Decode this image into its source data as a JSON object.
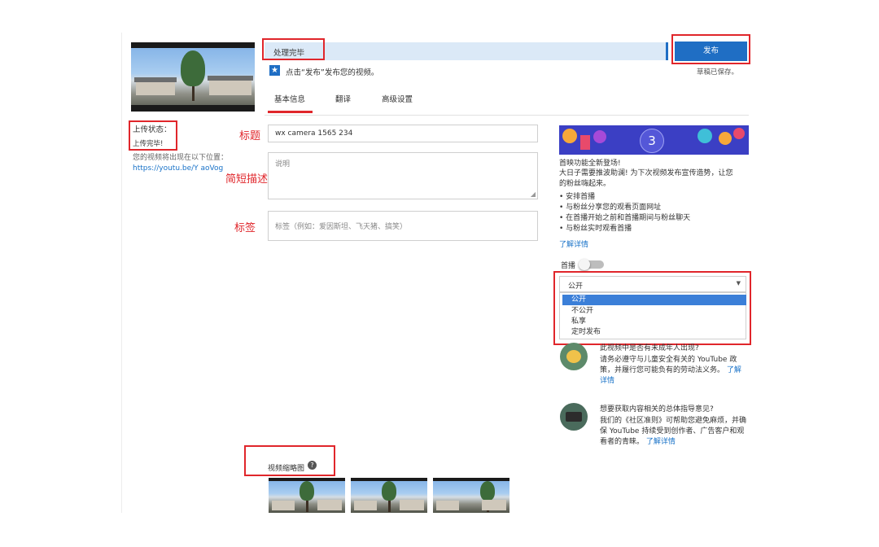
{
  "status_bar": {
    "processing_text": "处理完毕",
    "publish_button": "发布",
    "hint": "点击“发布”发布您的视频。",
    "draft_saved": "草稿已保存。"
  },
  "tabs": [
    {
      "label": "基本信息",
      "active": true
    },
    {
      "label": "翻译",
      "active": false
    },
    {
      "label": "高级设置",
      "active": false
    }
  ],
  "left_panel": {
    "upload_status_label": "上传状态：",
    "upload_status_value": "上传完毕!",
    "video_location_text": "您的视频将出现在以下位置：",
    "video_url": "https://youtu.be/Y          aoVog"
  },
  "annotations": {
    "title": "标题",
    "description": "简短描述",
    "tags": "标签"
  },
  "form": {
    "title_value": "wx camera 1565          234",
    "description_placeholder": "说明",
    "tags_placeholder": "标签（例如：爱因斯坦、飞天猪、搞笑）"
  },
  "premiere": {
    "banner_number": "3",
    "heading": "首映功能全新登场!",
    "intro": "大日子需要推波助澜! 为下次视频发布宣传造势，让您的粉丝嗨起来。",
    "bullets": [
      "安排首播",
      "与粉丝分享您的观看页面网址",
      "在首播开始之前和首播期间与粉丝聊天",
      "与粉丝实时观看首播"
    ],
    "learn_more": "了解详情",
    "toggle_label": "首播",
    "toggle_on": false
  },
  "visibility": {
    "selected": "公开",
    "options": [
      "公开",
      "不公开",
      "私享",
      "定时发布"
    ],
    "highlighted_index": 0
  },
  "info_cards": [
    {
      "title": "此视频中是否有未成年人出现?",
      "body": "请务必遵守与儿童安全有关的 YouTube 政策，并履行您可能负有的劳动法义务。",
      "link": "了解详情"
    },
    {
      "title": "想要获取内容相关的总体指导意见?",
      "body": "我们的《社区准则》可帮助您避免麻烦，并确保 YouTube 持续受到创作者、广告客户和观看者的青睐。",
      "link": "了解详情"
    }
  ],
  "thumbnails": {
    "label": "视频缩略图",
    "count": 3
  },
  "colors": {
    "annotation_red": "#e0262b",
    "publish_blue": "#1f6ec4",
    "progress_blue": "#dbe9f7",
    "link_blue": "#1a73c8"
  }
}
